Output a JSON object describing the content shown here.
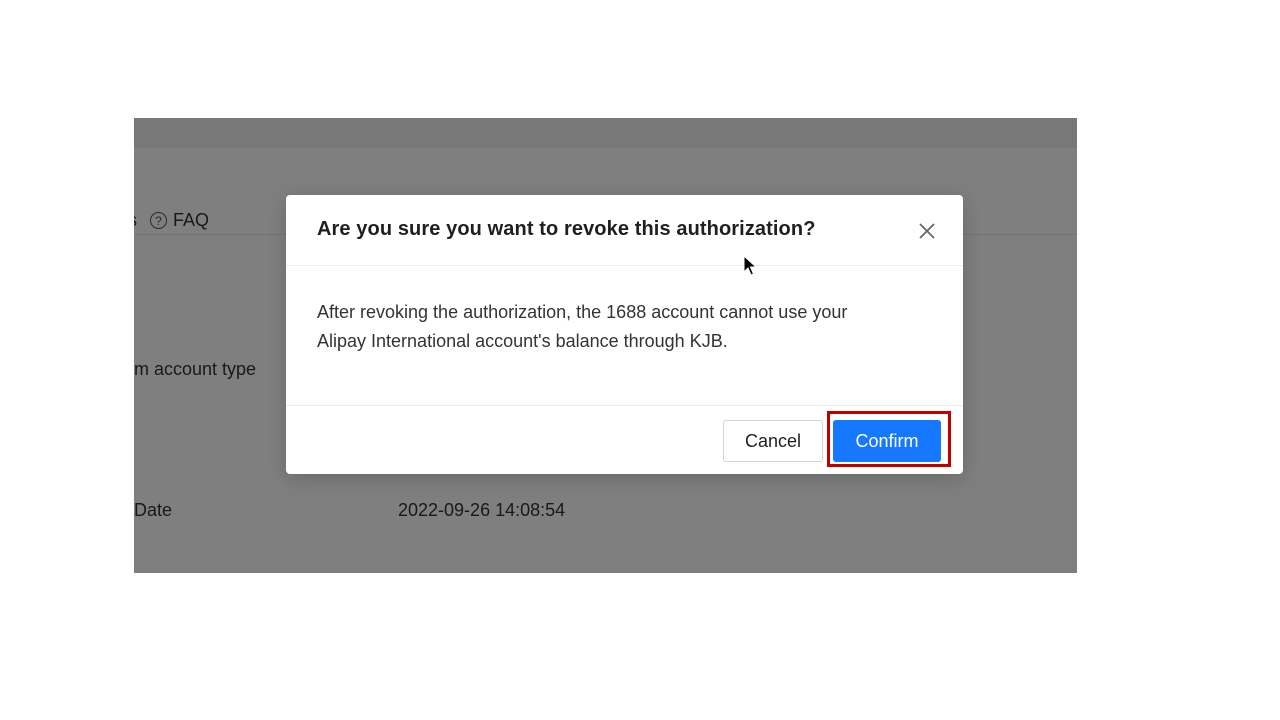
{
  "background_page": {
    "nav_fragment": "s",
    "faq_label": "FAQ",
    "faq_icon": "question-circle-icon",
    "fields": [
      {
        "label": "m account type",
        "value": ""
      },
      {
        "label": "Date",
        "value": "2022-09-26 14:08:54"
      }
    ]
  },
  "dialog": {
    "title": "Are you sure you want to revoke this authorization?",
    "close_icon": "close-icon",
    "message_line1": "After revoking the authorization, the 1688 account cannot use your",
    "message_line2": "Alipay International account's balance through KJB.",
    "cancel_label": "Cancel",
    "confirm_label": "Confirm"
  },
  "colors": {
    "primary": "#1677ff",
    "highlight": "#c00000"
  }
}
